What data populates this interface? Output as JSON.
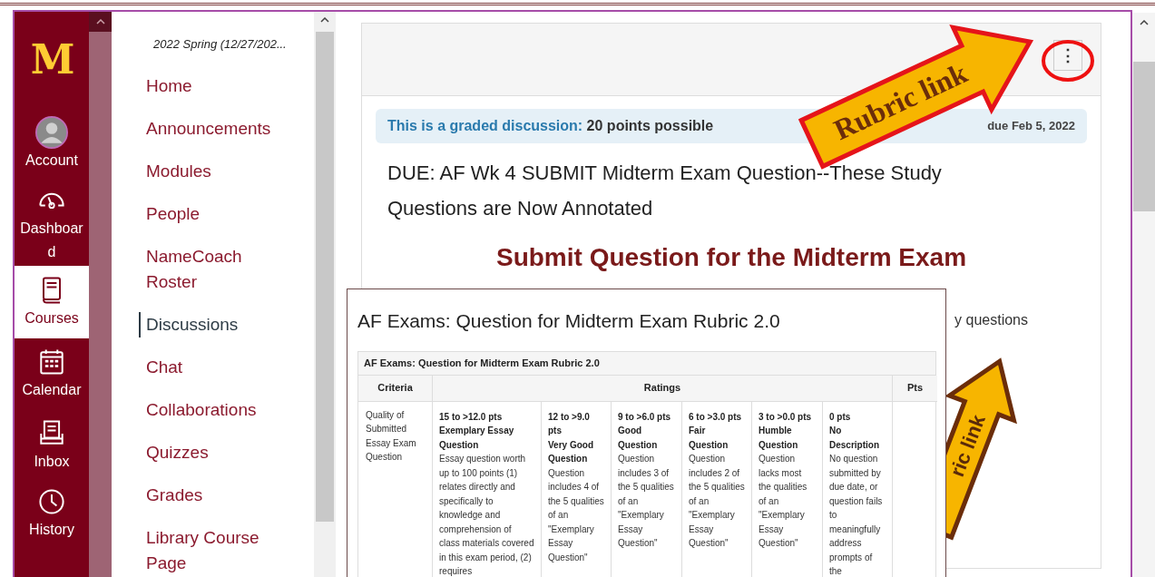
{
  "global_nav": {
    "logo": "M",
    "items": [
      {
        "label": "Account",
        "selected": false
      },
      {
        "label": "Dashboard",
        "selected": false
      },
      {
        "label": "Courses",
        "selected": true
      },
      {
        "label": "Calendar",
        "selected": false
      },
      {
        "label": "Inbox",
        "selected": false
      },
      {
        "label": "History",
        "selected": false
      }
    ]
  },
  "course_nav": {
    "term": "2022 Spring (12/27/202...",
    "items": [
      {
        "label": "Home",
        "selected": false
      },
      {
        "label": "Announcements",
        "selected": false
      },
      {
        "label": "Modules",
        "selected": false
      },
      {
        "label": "People",
        "selected": false
      },
      {
        "label": "NameCoach Roster",
        "selected": false
      },
      {
        "label": "Discussions",
        "selected": true
      },
      {
        "label": "Chat",
        "selected": false
      },
      {
        "label": "Collaborations",
        "selected": false
      },
      {
        "label": "Quizzes",
        "selected": false
      },
      {
        "label": "Grades",
        "selected": false
      },
      {
        "label": "Library Course Page",
        "selected": false
      }
    ]
  },
  "discussion": {
    "menu_button": "⋮",
    "graded_label": "This is a graded discussion:",
    "points": "20 points possible",
    "due": "due Feb 5, 2022",
    "title": "DUE: AF Wk 4 SUBMIT Midterm Exam Question--These Study Questions are Now Annotated",
    "heading": "Submit Question for the Midterm Exam",
    "partial_text": "y questions"
  },
  "annotations": [
    {
      "text": "Rubric link"
    },
    {
      "text": "ric link"
    }
  ],
  "rubric": {
    "title": "AF Exams: Question for Midterm Exam Rubric 2.0",
    "table_title": "AF Exams: Question for Midterm Exam Rubric 2.0",
    "columns": [
      "Criteria",
      "Ratings",
      "Pts"
    ],
    "rows": [
      {
        "criterion": "Quality of Submitted Essay Exam Question",
        "ratings": [
          {
            "points": "15 to >12.0 pts",
            "name": "Exemplary Essay Question",
            "description": "Essay question worth up to 100 points (1) relates directly and specifically to knowledge and comprehension of class materials covered in this exam period, (2) requires"
          },
          {
            "points": "12 to >9.0 pts",
            "name": "Very Good Question",
            "description": "Question includes 4 of the 5 qualities of an \"Exemplary Essay Question\""
          },
          {
            "points": "9 to >6.0 pts",
            "name": "Good Question",
            "description": "Question includes 3 of the 5 qualities of an \"Exemplary Essay Question\""
          },
          {
            "points": "6 to >3.0 pts",
            "name": "Fair Question",
            "description": "Question includes 2 of the 5 qualities of an \"Exemplary Essay Question\""
          },
          {
            "points": "3 to >0.0 pts",
            "name": "Humble Question",
            "description": "Question lacks most the qualities of an \"Exemplary Essay Question\""
          },
          {
            "points": "0 pts",
            "name": "No Description",
            "description": "No question submitted by due date, or question fails to meaningfully address prompts of the"
          }
        ]
      }
    ]
  }
}
